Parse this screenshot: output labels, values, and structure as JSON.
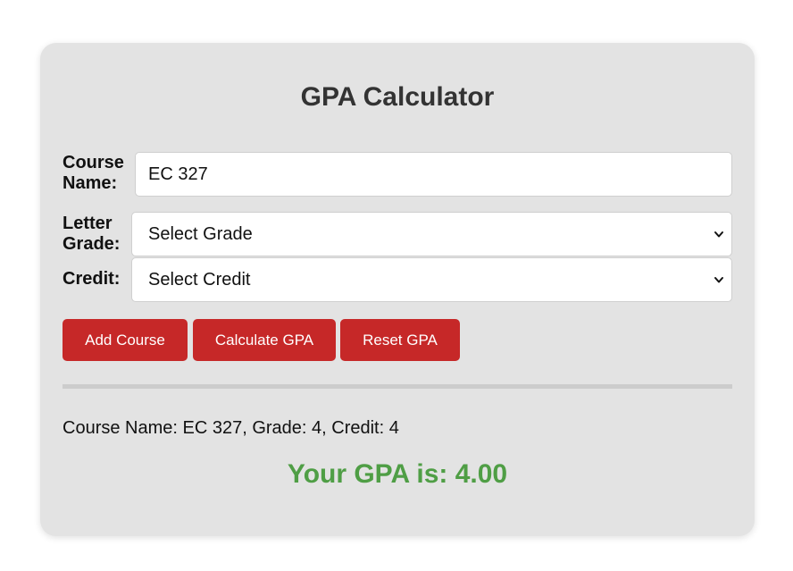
{
  "title": "GPA Calculator",
  "form": {
    "course_name_label": "Course Name:",
    "course_name_value": "EC 327",
    "letter_grade_label": "Letter Grade:",
    "letter_grade_selected": "Select Grade",
    "credit_label": "Credit:",
    "credit_selected": "Select Credit"
  },
  "buttons": {
    "add_course": "Add Course",
    "calculate_gpa": "Calculate GPA",
    "reset_gpa": "Reset GPA"
  },
  "courses": [
    "Course Name: EC 327, Grade: 4, Credit: 4"
  ],
  "result": "Your GPA is: 4.00",
  "colors": {
    "card_background": "#e3e3e3",
    "button": "#c62828",
    "result_text": "#4f9e45"
  },
  "icons": [
    "chevron-down-icon"
  ]
}
